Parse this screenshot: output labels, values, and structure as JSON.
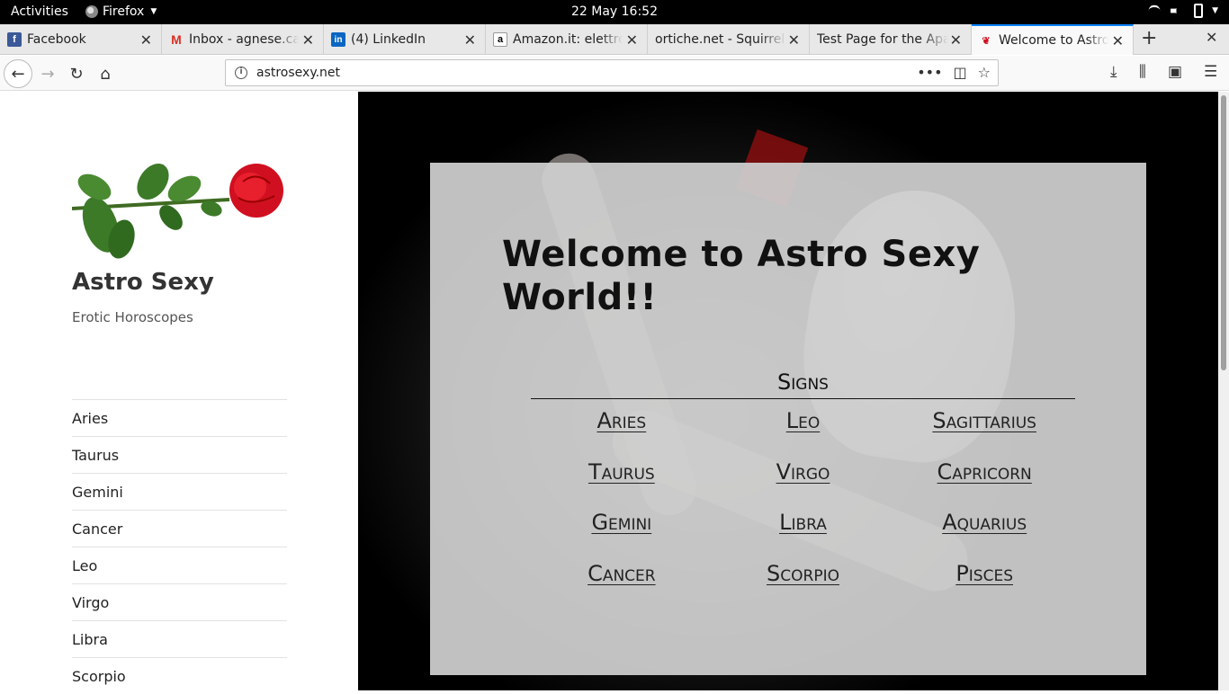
{
  "topbar": {
    "activities": "Activities",
    "app_name": "Firefox",
    "clock": "22 May  16:52"
  },
  "tabs": [
    {
      "title": "Facebook",
      "icon": "facebook-icon"
    },
    {
      "title": "Inbox - agnese.car",
      "icon": "gmail-icon"
    },
    {
      "title": "(4) LinkedIn",
      "icon": "linkedin-icon"
    },
    {
      "title": "Amazon.it: elettro",
      "icon": "amazon-icon"
    },
    {
      "title": "ortiche.net - Squirrel",
      "icon": ""
    },
    {
      "title": "Test Page for the Apa",
      "icon": ""
    },
    {
      "title": "Welcome to Astro",
      "icon": "rose-icon",
      "active": true
    }
  ],
  "navbar": {
    "url": "astrosexy.net"
  },
  "site": {
    "title": "Astro Sexy",
    "description": "Erotic Horoscopes",
    "menu": [
      "Aries",
      "Taurus",
      "Gemini",
      "Cancer",
      "Leo",
      "Virgo",
      "Libra",
      "Scorpio"
    ]
  },
  "main": {
    "heading": "Welcome to Astro Sexy World!!",
    "signs_header": "Signs",
    "signs": [
      "Aries",
      "Leo",
      "Sagittarius",
      "Taurus",
      "Virgo",
      "Capricorn",
      "Gemini",
      "Libra",
      "Aquarius",
      "Cancer",
      "Scorpio",
      "Pisces"
    ]
  },
  "colors": {
    "accent_tab": "#0a84ff",
    "rose_red": "#d01020",
    "panel_bg": "#d0d0d0"
  }
}
